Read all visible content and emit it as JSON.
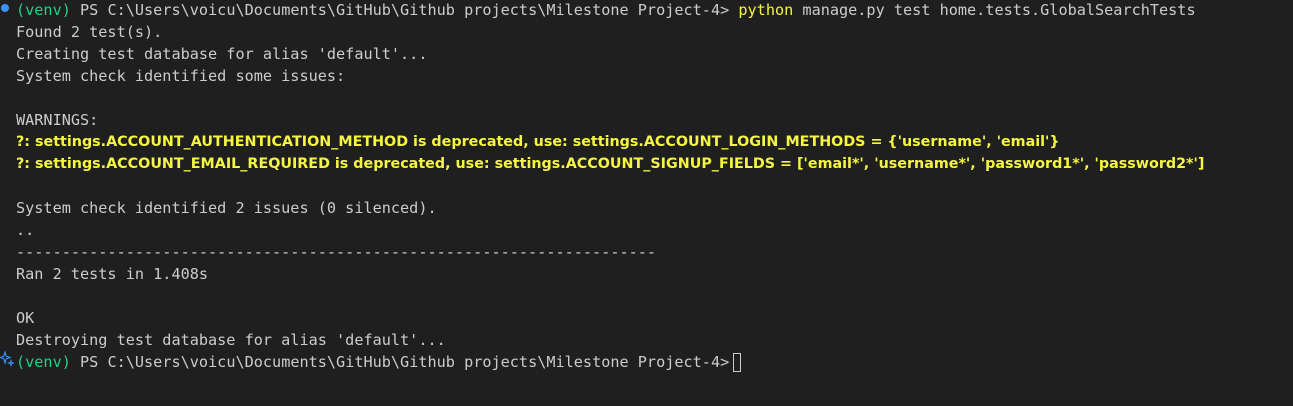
{
  "terminal": {
    "prompt_env": "(venv)",
    "prompt_path": "PS C:\\Users\\voicu\\Documents\\GitHub\\Github projects\\Milestone Project-4>",
    "command_program": "python",
    "command_args": "manage.py test home.tests.GlobalSearchTests",
    "lines": {
      "found": "Found 2 test(s).",
      "creating": "Creating test database for alias 'default'...",
      "syscheck": "System check identified some issues:",
      "warnings_header": "WARNINGS:",
      "warning_1": "?: settings.ACCOUNT_AUTHENTICATION_METHOD is deprecated, use: settings.ACCOUNT_LOGIN_METHODS = {'username', 'email'}",
      "warning_2": "?: settings.ACCOUNT_EMAIL_REQUIRED is deprecated, use: settings.ACCOUNT_SIGNUP_FIELDS = ['email*', 'username*', 'password1*', 'password2*']",
      "syscheck_result": "System check identified 2 issues (0 silenced).",
      "dots": "..",
      "separator": "----------------------------------------------------------------------",
      "ran": "Ran 2 tests in 1.408s",
      "ok": "OK",
      "destroying": "Destroying test database for alias 'default'..."
    },
    "icons": {
      "status_dot": "status-dot-icon",
      "sparkle": "sparkle-icon"
    },
    "colors": {
      "background": "#1f1f1f",
      "text": "#cccccc",
      "venv": "#23d18b",
      "warning": "#f5f543",
      "status_dot": "#3794ff"
    }
  }
}
